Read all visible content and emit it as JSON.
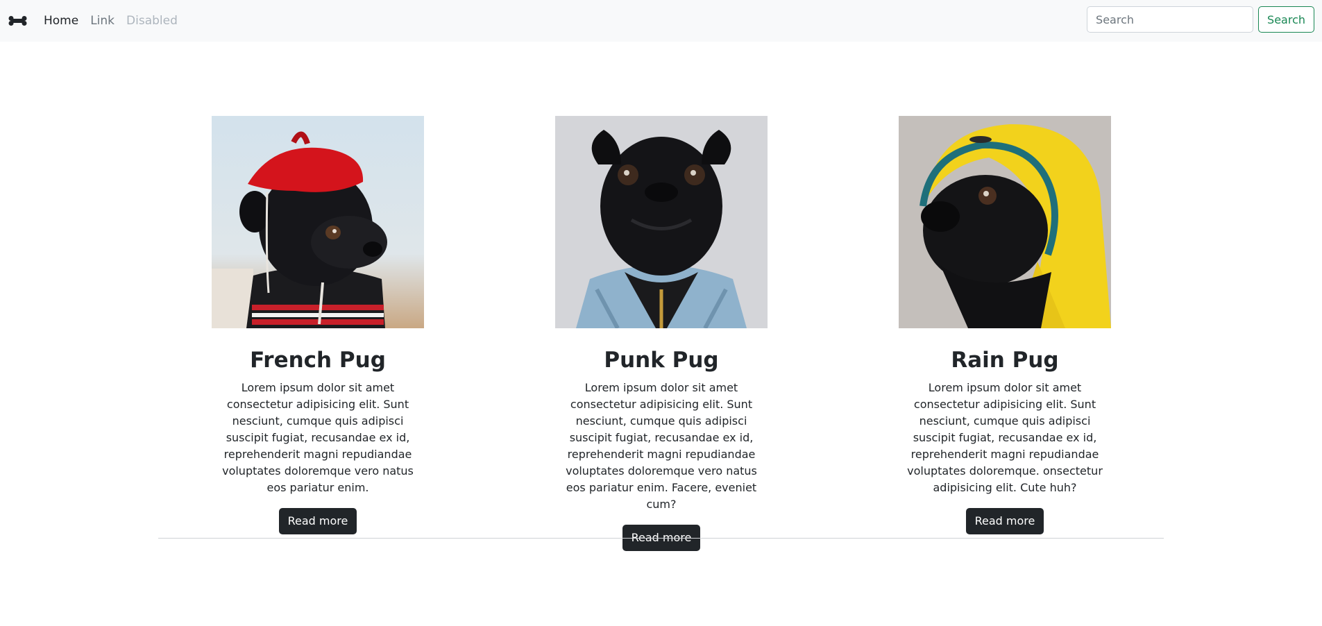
{
  "navbar": {
    "brand_icon": "bone-icon",
    "links": [
      {
        "label": "Home",
        "state": "active"
      },
      {
        "label": "Link",
        "state": "normal"
      },
      {
        "label": "Disabled",
        "state": "disabled"
      }
    ],
    "search": {
      "placeholder": "Search",
      "value": "",
      "button_label": "Search"
    }
  },
  "colors": {
    "navbar_bg": "#f8f9fa",
    "search_button": "#198754",
    "read_more_button": "#212529"
  },
  "cards": [
    {
      "image_desc": "black pug wearing red beret and striped sweater",
      "title": "French Pug",
      "text": "Lorem ipsum dolor sit amet consectetur adipisicing elit. Sunt nesciunt, cumque quis adipisci suscipit fugiat, recusandae ex id, reprehenderit magni repudiandae voluptates doloremque vero natus eos pariatur enim.",
      "button_label": "Read more"
    },
    {
      "image_desc": "black pug wearing denim jacket",
      "title": "Punk Pug",
      "text": "Lorem ipsum dolor sit amet consectetur adipisicing elit. Sunt nesciunt, cumque quis adipisci suscipit fugiat, recusandae ex id, reprehenderit magni repudiandae voluptates doloremque vero natus eos pariatur enim. Facere, eveniet cum?",
      "button_label": "Read more"
    },
    {
      "image_desc": "black pug wearing yellow raincoat hood",
      "title": "Rain Pug",
      "text": "Lorem ipsum dolor sit amet consectetur adipisicing elit. Sunt nesciunt, cumque quis adipisci suscipit fugiat, recusandae ex id, reprehenderit magni repudiandae voluptates doloremque. onsectetur adipisicing elit. Cute huh?",
      "button_label": "Read more"
    }
  ]
}
